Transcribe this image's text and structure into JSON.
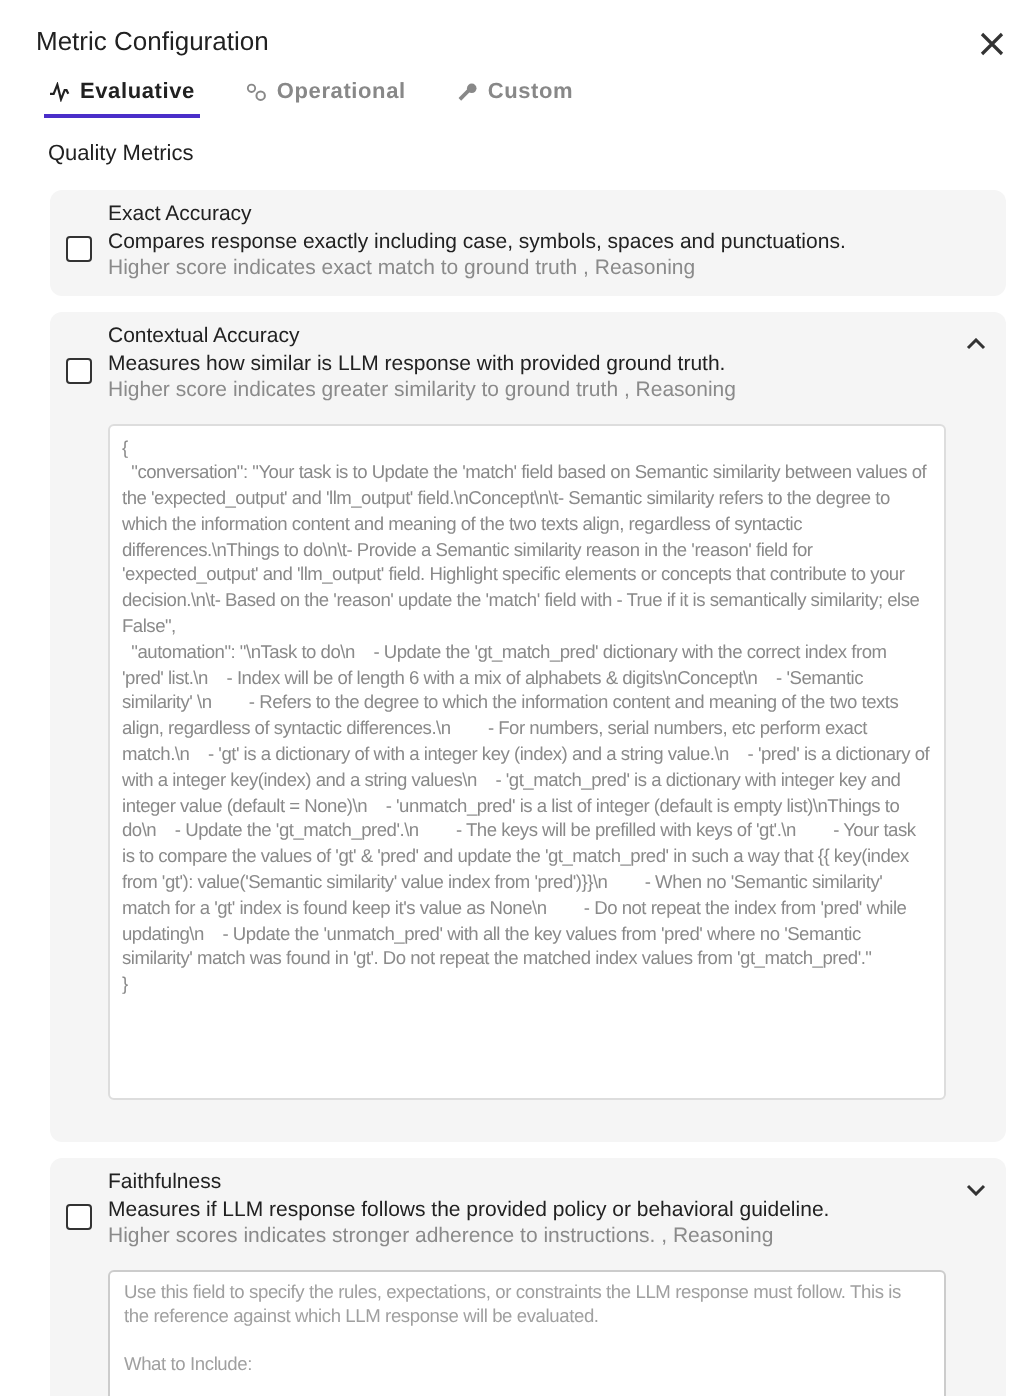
{
  "dialog": {
    "title": "Metric Configuration"
  },
  "tabs": [
    {
      "label": "Evaluative",
      "selected": true
    },
    {
      "label": "Operational",
      "selected": false
    },
    {
      "label": "Custom",
      "selected": false
    }
  ],
  "section_title": "Quality Metrics",
  "metrics": [
    {
      "name": "Exact Accuracy",
      "description": "Compares response exactly including case, symbols, spaces and punctuations.",
      "hint": "Higher score indicates exact match to ground truth , Reasoning",
      "checked": false
    },
    {
      "name": "Contextual Accuracy",
      "description": "Measures how similar is LLM response with provided ground truth.",
      "hint": "Higher score indicates greater similarity to ground truth , Reasoning",
      "checked": false,
      "expanded": true,
      "prompt": {
        "value": "{\n  \"conversation\": \"Your task is to Update the 'match' field based on Semantic similarity between values of the 'expected_output' and 'llm_output' field.\\nConcept\\n\\t- Semantic similarity refers to the degree to which the information content and meaning of the two texts align, regardless of syntactic differences.\\nThings to do\\n\\t- Provide a Semantic similarity reason in the 'reason' field for 'expected_output' and 'llm_output' field. Highlight specific elements or concepts that contribute to your decision.\\n\\t- Based on the 'reason' update the 'match' field with - True if it is semantically similarity; else False\",\n  \"automation\": \"\\nTask to do\\n    - Update the 'gt_match_pred' dictionary with the correct index from 'pred' list.\\n    - Index will be of length 6 with a mix of alphabets & digits\\nConcept\\n    - 'Semantic similarity' \\n        - Refers to the degree to which the information content and meaning of the two texts align, regardless of syntactic differences.\\n        - For numbers, serial numbers, etc perform exact match.\\n    - 'gt' is a dictionary of with a integer key (index) and a string value.\\n    - 'pred' is a dictionary of with a integer key(index) and a string values\\n    - 'gt_match_pred' is a dictionary with integer key and integer value (default = None)\\n    - 'unmatch_pred' is a list of integer (default is empty list)\\nThings to do\\n    - Update the 'gt_match_pred'.\\n        - The keys will be prefilled with keys of 'gt'.\\n        - Your task is to compare the values of 'gt' & 'pred' and update the 'gt_match_pred' in such a way that {{ key(index from 'gt'): value('Semantic similarity' value index from 'pred')}}\\n        - When no 'Semantic similarity' match for a 'gt' index is found keep it's value as None\\n        - Do not repeat the index from 'pred' while updating\\n    - Update the 'unmatch_pred' with all the key values from 'pred' where no 'Semantic similarity' match was found in 'gt'. Do not repeat the matched index values from 'gt_match_pred'.\"\n}"
      }
    },
    {
      "name": "Faithfulness",
      "description": "Measures if LLM response follows the provided policy or behavioral guideline.",
      "hint": "Higher scores indicates stronger adherence to instructions. , Reasoning",
      "checked": false,
      "expanded": false,
      "prompt": {
        "placeholder": "Use this field to specify the rules, expectations, or constraints the LLM response must follow. This is the reference against which LLM response will be evaluated.\n\nWhat to Include:"
      }
    }
  ]
}
